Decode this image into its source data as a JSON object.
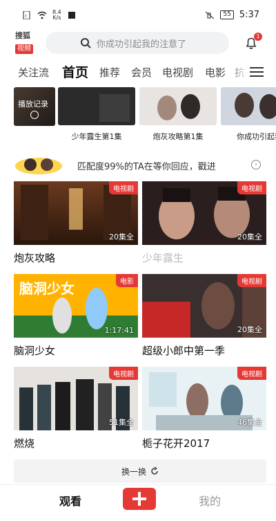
{
  "status_bar": {
    "net_speed_value": "8.4",
    "net_speed_unit": "K/s",
    "battery": "55",
    "time": "5:37"
  },
  "header": {
    "logo_line1": "搜狐",
    "logo_line2": "视频",
    "search_placeholder": "你成功引起我的注意了",
    "notification_count": "1"
  },
  "tabs": [
    "关注流",
    "首页",
    "推荐",
    "会员",
    "电视剧",
    "电影",
    "抗"
  ],
  "active_tab_index": 1,
  "history": {
    "first_label": "播放记录",
    "items": [
      {
        "label": "少年露生第1集"
      },
      {
        "label": "炮灰攻略第1集"
      },
      {
        "label": "你成功引起我"
      }
    ]
  },
  "banner": {
    "text": "匹配度99%的TA在等你回应，戳进"
  },
  "cards": [
    {
      "title": "炮灰攻略",
      "badge": "电视剧",
      "episodes": "20集全",
      "dim": false
    },
    {
      "title": "少年露生",
      "badge": "电视剧",
      "episodes": "20集全",
      "dim": true
    },
    {
      "title": "脑洞少女",
      "badge": "电影",
      "episodes": "1:17:41",
      "dim": false
    },
    {
      "title": "超级小郎中第一季",
      "badge": "电视剧",
      "episodes": "20集全",
      "dim": false
    },
    {
      "title": "燃烧",
      "badge": "电视剧",
      "episodes": "51集全",
      "dim": false
    },
    {
      "title": "栀子花开2017",
      "badge": "电视剧",
      "episodes": "46集全",
      "dim": false
    }
  ],
  "refresh_label": "换一换",
  "bottom_nav": {
    "watch": "观看",
    "mine": "我的"
  },
  "colors": {
    "accent": "#e53935",
    "text": "#111111",
    "muted": "#999999"
  }
}
